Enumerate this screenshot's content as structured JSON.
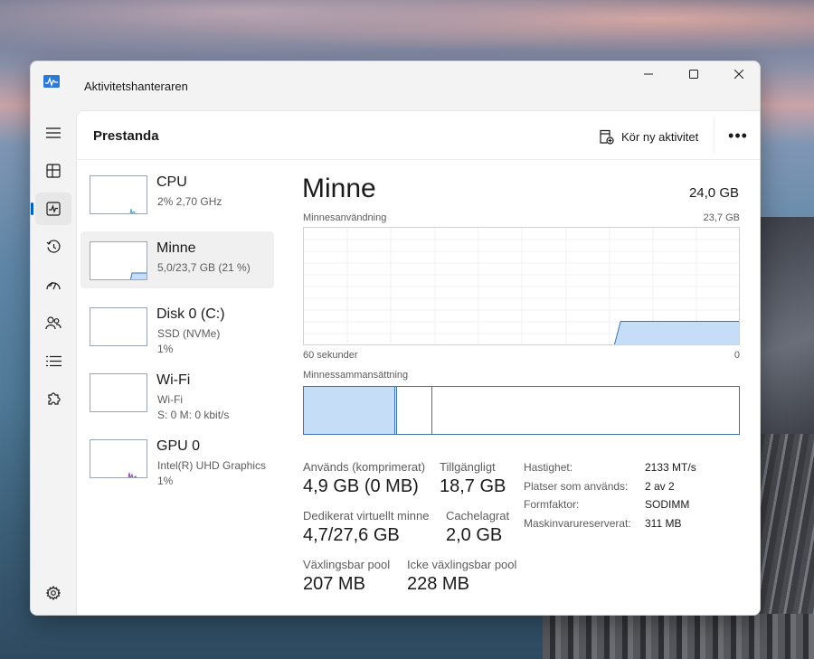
{
  "window": {
    "title": "Aktivitetshanteraren"
  },
  "nav": [
    {
      "name": "nav-menu",
      "icon": "hamburger-icon"
    },
    {
      "name": "nav-processes",
      "icon": "processes-icon"
    },
    {
      "name": "nav-performance",
      "icon": "performance-icon",
      "active": true
    },
    {
      "name": "nav-app-history",
      "icon": "history-icon"
    },
    {
      "name": "nav-startup",
      "icon": "startup-icon"
    },
    {
      "name": "nav-users",
      "icon": "users-icon"
    },
    {
      "name": "nav-details",
      "icon": "details-list-icon"
    },
    {
      "name": "nav-services",
      "icon": "services-puzzle-icon"
    },
    {
      "name": "nav-settings",
      "icon": "gear-icon"
    }
  ],
  "header": {
    "title": "Prestanda",
    "run_task_label": "Kör ny aktivitet",
    "more_label": "•••"
  },
  "perf_items": [
    {
      "name": "CPU",
      "sub1": "2% 2,70 GHz",
      "sub2": "",
      "color": "#4ba3c3",
      "selected": false
    },
    {
      "name": "Minne",
      "sub1": "5,0/23,7 GB (21 %)",
      "sub2": "",
      "color": "#3e73b0",
      "selected": true
    },
    {
      "name": "Disk 0 (C:)",
      "sub1": "SSD (NVMe)",
      "sub2": "1%",
      "color": "#4c9a2a",
      "selected": false
    },
    {
      "name": "Wi-Fi",
      "sub1": "Wi-Fi",
      "sub2": "S: 0 M: 0 kbit/s",
      "color": "#a74f01",
      "selected": false
    },
    {
      "name": "GPU 0",
      "sub1": "Intel(R) UHD Graphics",
      "sub2": "1%",
      "color": "#8e44ad",
      "selected": false
    }
  ],
  "memory": {
    "title": "Minne",
    "total": "24,0 GB",
    "usage_label": "Minnesanvändning",
    "usage_max": "23,7 GB",
    "time_left": "60 sekunder",
    "time_right": "0",
    "composition_label": "Minnessammansättning",
    "in_use_fraction": 0.21,
    "composition": {
      "in_use": 0.21,
      "modified": 0.005,
      "standby": 0.08
    },
    "colors": {
      "line": "#3e73b0",
      "fill": "#c6ddf7"
    }
  },
  "stats": {
    "in_use_label": "Används (komprimerat)",
    "in_use_value": "4,9 GB (0 MB)",
    "available_label": "Tillgängligt",
    "available_value": "18,7 GB",
    "committed_label": "Dedikerat virtuellt minne",
    "committed_value": "4,7/27,6 GB",
    "cached_label": "Cachelagrat",
    "cached_value": "2,0 GB",
    "paged_label": "Växlingsbar pool",
    "paged_value": "207 MB",
    "nonpaged_label": "Icke växlingsbar pool",
    "nonpaged_value": "228 MB"
  },
  "specs": [
    {
      "label": "Hastighet:",
      "value": "2133 MT/s"
    },
    {
      "label": "Platser som används:",
      "value": "2 av 2"
    },
    {
      "label": "Formfaktor:",
      "value": "SODIMM"
    },
    {
      "label": "Maskinvarureserverat:",
      "value": "311 MB"
    }
  ]
}
